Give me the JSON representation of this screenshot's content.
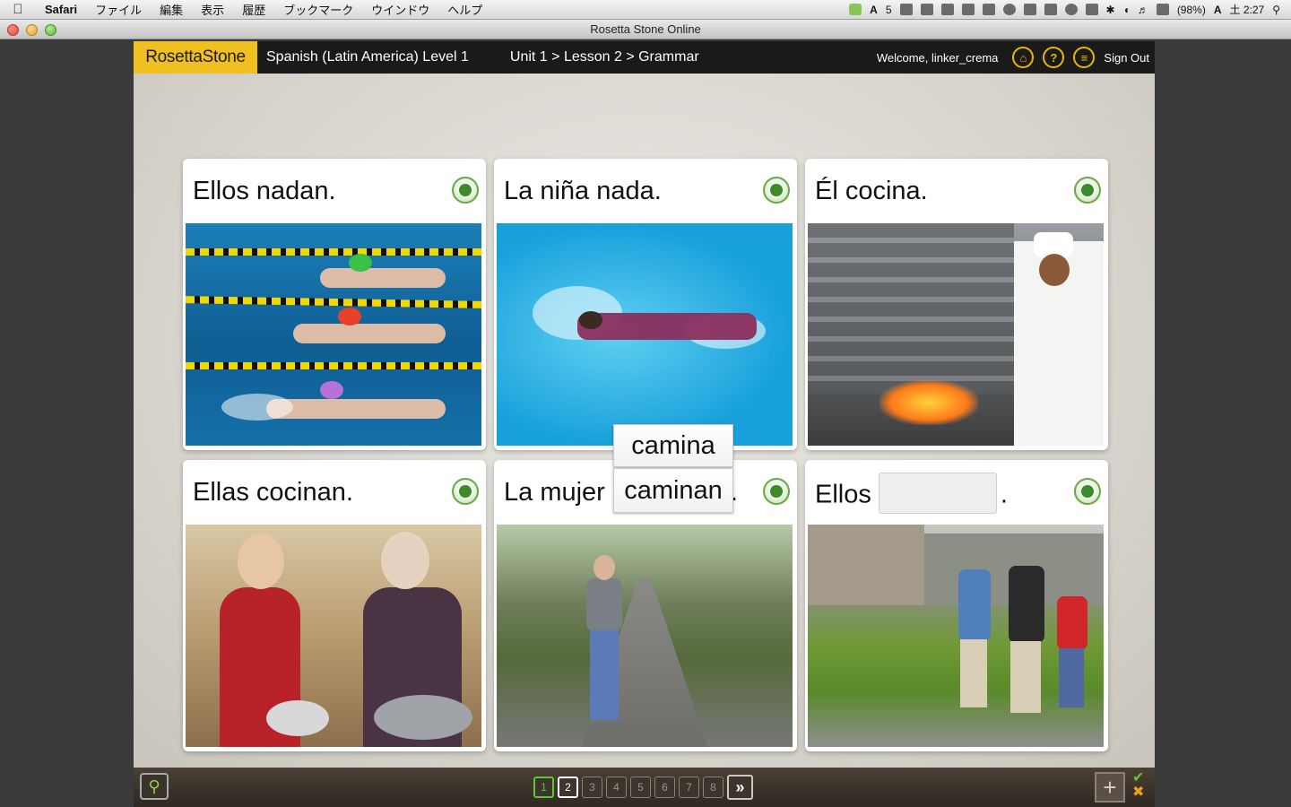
{
  "menubar": {
    "app_name": "Safari",
    "items": [
      "ファイル",
      "編集",
      "表示",
      "履歴",
      "ブックマーク",
      "ウインドウ",
      "ヘルプ"
    ],
    "tray_text": "5",
    "battery": "(98%)",
    "clock": "土 2:27"
  },
  "window": {
    "title": "Rosetta Stone Online"
  },
  "header": {
    "logo": "RosettaStone",
    "course": "Spanish (Latin America) Level 1",
    "breadcrumb": "Unit 1 > Lesson 2 > Grammar",
    "welcome": "Welcome, linker_crema",
    "help_icon": "?",
    "sign_out": "Sign Out"
  },
  "cards": [
    {
      "caption": "Ellos nadan.",
      "image": "swimmers-racing"
    },
    {
      "caption": "La niña nada.",
      "image": "girl-swimming"
    },
    {
      "caption": "Él cocina.",
      "image": "chef-cooking"
    },
    {
      "caption": "Ellas cocinan.",
      "image": "women-cooking"
    },
    {
      "caption_before": "La mujer",
      "caption_after": ".",
      "image": "woman-walking"
    },
    {
      "caption_before": "Ellos",
      "caption_after": ".",
      "image": "men-walking"
    }
  ],
  "tiles": {
    "option_1": "camina",
    "option_2": "caminan"
  },
  "pager": {
    "pages": [
      "1",
      "2",
      "3",
      "4",
      "5",
      "6",
      "7",
      "8"
    ],
    "done_page": "1",
    "current_page": "2",
    "next_label": "»"
  },
  "footer": {
    "add_label": "+",
    "check_label": "✔",
    "cross_label": "✖"
  },
  "colors": {
    "accent": "#f0c020",
    "success": "#5ec43a",
    "header_bg": "#1a1a1a",
    "footer_bg": "#3a3129"
  }
}
